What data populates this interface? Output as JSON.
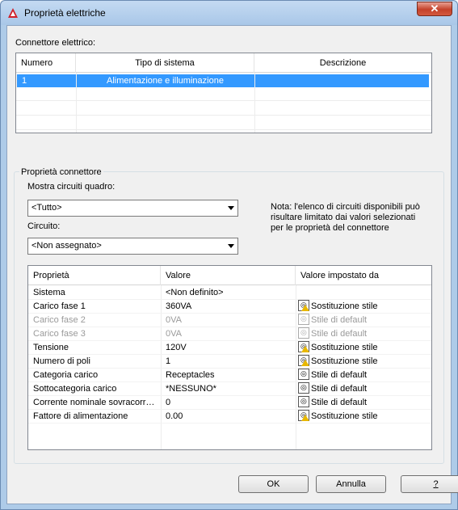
{
  "window": {
    "title": "Proprietà elettriche",
    "close_label": "✕"
  },
  "connector": {
    "label": "Connettore elettrico:",
    "columns": [
      "Numero",
      "Tipo di sistema",
      "Descrizione"
    ],
    "rows": [
      {
        "numero": "1",
        "tipo": "Alimentazione e illuminazione",
        "descrizione": ""
      }
    ]
  },
  "connector_props": {
    "group_title": "Proprietà connettore",
    "mostra_label": "Mostra circuiti quadro:",
    "mostra_value": "<Tutto>",
    "circuito_label": "Circuito:",
    "circuito_value": "<Non assegnato>",
    "note": "Nota: l'elenco di circuiti disponibili può risultare limitato dai valori selezionati per le proprietà del connettore"
  },
  "props_table": {
    "columns": [
      "Proprietà",
      "Valore",
      "Valore impostato da"
    ],
    "rows": [
      {
        "prop": "Sistema",
        "val": "<Non definito>",
        "src": "",
        "icon": "none",
        "disabled": false
      },
      {
        "prop": "Carico fase 1",
        "val": "360VA",
        "src": "Sostituzione stile",
        "icon": "override",
        "disabled": false
      },
      {
        "prop": "Carico fase 2",
        "val": "0VA",
        "src": "Stile di default",
        "icon": "default",
        "disabled": true
      },
      {
        "prop": "Carico fase 3",
        "val": "0VA",
        "src": "Stile di default",
        "icon": "default",
        "disabled": true
      },
      {
        "prop": "Tensione",
        "val": "120V",
        "src": "Sostituzione stile",
        "icon": "override",
        "disabled": false
      },
      {
        "prop": "Numero di poli",
        "val": "1",
        "src": "Sostituzione stile",
        "icon": "override",
        "disabled": false
      },
      {
        "prop": "Categoria carico",
        "val": "Receptacles",
        "src": "Stile di default",
        "icon": "default",
        "disabled": false
      },
      {
        "prop": "Sottocategoria carico",
        "val": "*NESSUNO*",
        "src": "Stile di default",
        "icon": "default",
        "disabled": false
      },
      {
        "prop": "Corrente nominale sovracorr…",
        "val": "0",
        "src": "Stile di default",
        "icon": "default",
        "disabled": false
      },
      {
        "prop": "Fattore di alimentazione",
        "val": "0.00",
        "src": "Sostituzione stile",
        "icon": "override",
        "disabled": false
      }
    ]
  },
  "buttons": {
    "ok": "OK",
    "cancel": "Annulla",
    "help": "?"
  },
  "colors": {
    "selection": "#3399ff",
    "title_bar": "#aecbe8",
    "close": "#c4422a"
  }
}
